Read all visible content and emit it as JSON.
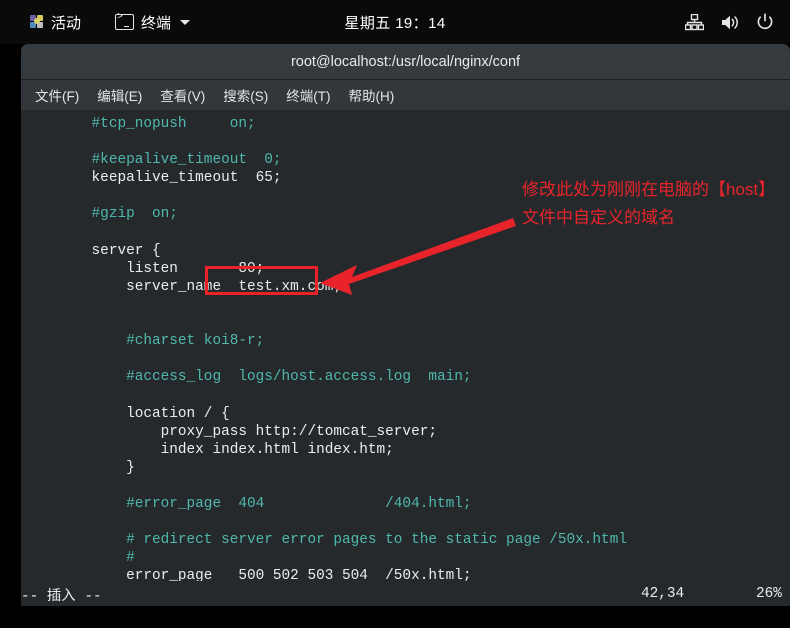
{
  "topbar": {
    "activities_label": "活动",
    "activities_icon": "fedora-app-grid-icon",
    "app_window_label": "终端",
    "app_window_icon": "terminal-icon",
    "clock": "星期五 19：14",
    "status_icons": [
      "network-wired-icon",
      "volume-icon",
      "power-icon"
    ]
  },
  "window": {
    "title": "root@localhost:/usr/local/nginx/conf",
    "menu": [
      "文件(F)",
      "编辑(E)",
      "查看(V)",
      "搜索(S)",
      "终端(T)",
      "帮助(H)"
    ]
  },
  "editor": {
    "lines": [
      {
        "text": "    #tcp_nopush     on;",
        "comment": true
      },
      {
        "text": "",
        "comment": false
      },
      {
        "text": "    #keepalive_timeout  0;",
        "comment": true
      },
      {
        "text": "    keepalive_timeout  65;",
        "comment": false
      },
      {
        "text": "",
        "comment": false
      },
      {
        "text": "    #gzip  on;",
        "comment": true
      },
      {
        "text": "",
        "comment": false
      },
      {
        "text": "    server {",
        "comment": false
      },
      {
        "text": "        listen       80;",
        "comment": false
      },
      {
        "text": "        server_name  test.xm.com;",
        "comment": false
      },
      {
        "text": "",
        "comment": false
      },
      {
        "text": "",
        "comment": false
      },
      {
        "text": "        #charset koi8-r;",
        "comment": true
      },
      {
        "text": "",
        "comment": false
      },
      {
        "text": "        #access_log  logs/host.access.log  main;",
        "comment": true
      },
      {
        "text": "",
        "comment": false
      },
      {
        "text": "        location / {",
        "comment": false
      },
      {
        "text": "            proxy_pass http://tomcat_server;",
        "comment": false
      },
      {
        "text": "            index index.html index.htm;",
        "comment": false
      },
      {
        "text": "        }",
        "comment": false
      },
      {
        "text": "",
        "comment": false
      },
      {
        "text": "        #error_page  404              /404.html;",
        "comment": true
      },
      {
        "text": "",
        "comment": false
      },
      {
        "text": "        # redirect server error pages to the static page /50x.html",
        "comment": true
      },
      {
        "text": "        #",
        "comment": true
      },
      {
        "text": "        error_page   500 502 503 504  /50x.html;",
        "comment": false
      }
    ],
    "status": {
      "mode": "-- 插入 --",
      "position": "42,34",
      "percent": "26%"
    }
  },
  "annotation": {
    "text": "修改此处为刚刚在电脑的【host】文件中自定义的域名",
    "color": "#e8242a",
    "highlight_target": "test.xm.com;"
  },
  "colors": {
    "comment": "#4fb8ac",
    "code": "#ececec",
    "terminal_bg": "#26292c",
    "titlebar_bg": "#353a3f",
    "annotation_red": "#e8242a"
  }
}
